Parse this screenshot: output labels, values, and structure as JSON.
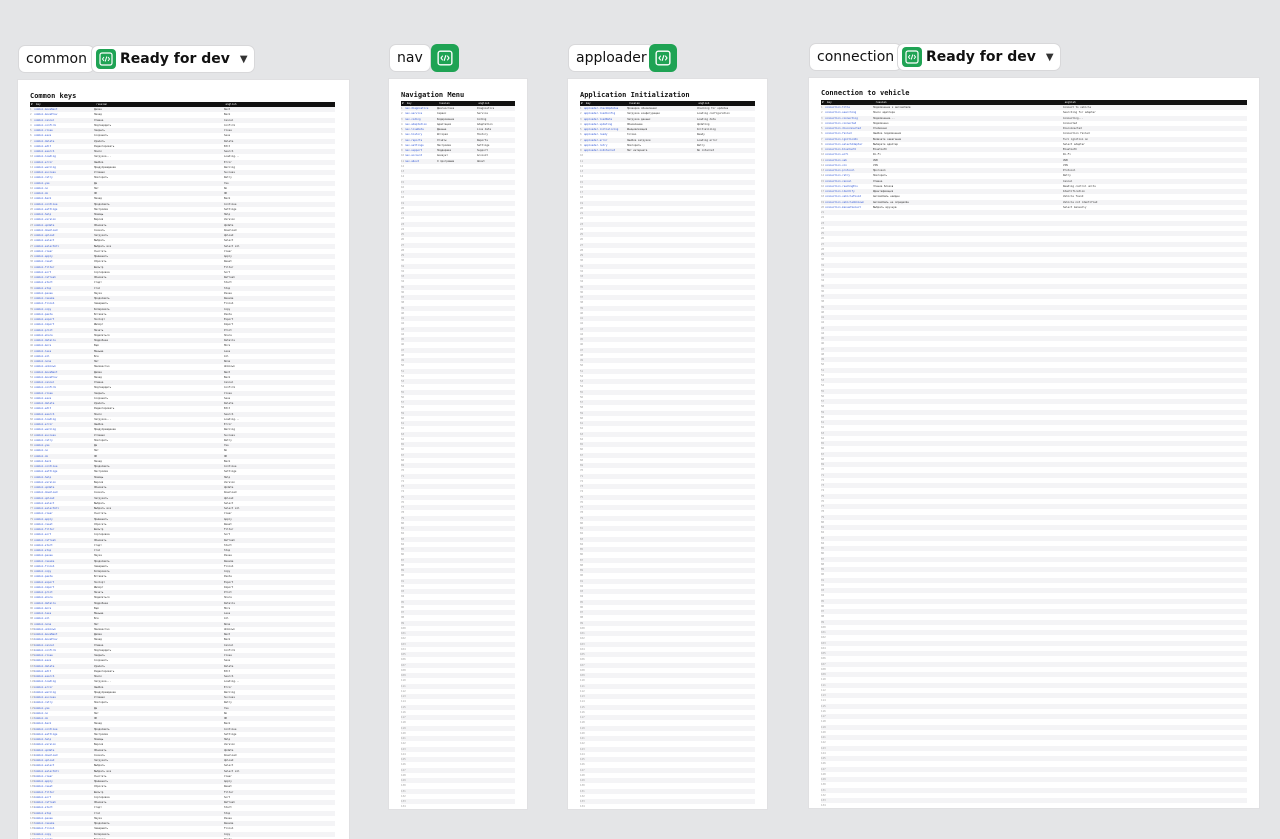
{
  "colors": {
    "canvas_bg": "#e4e5e7",
    "dev_green": "#1fa354",
    "link_blue": "#2e55d6",
    "header_black": "#111111"
  },
  "icons": {
    "dev_mode": "code-brackets-icon",
    "dropdown": "chevron-down-icon"
  },
  "sections": [
    {
      "name": "common",
      "status": "Ready for dev",
      "title": "Common keys"
    },
    {
      "name": "nav",
      "status": "",
      "title": "Navigation Menu"
    },
    {
      "name": "apploader",
      "status": "",
      "title": "Application Initialization"
    },
    {
      "name": "connection",
      "status": "Ready for dev",
      "title": "Connection to vehicle"
    }
  ],
  "table_headers": [
    "#",
    "key",
    "russian",
    "english"
  ],
  "tables": {
    "common": [
      [
        "common.moveNext",
        "Далее",
        "Next"
      ],
      [
        "common.movePrev",
        "Назад",
        "Back"
      ],
      [
        "common.cancel",
        "Отмена",
        "Cancel"
      ],
      [
        "common.confirm",
        "Подтвердить",
        "Confirm"
      ],
      [
        "common.close",
        "Закрыть",
        "Close"
      ],
      [
        "common.save",
        "Сохранить",
        "Save"
      ],
      [
        "common.delete",
        "Удалить",
        "Delete"
      ],
      [
        "common.edit",
        "Редактировать",
        "Edit"
      ],
      [
        "common.search",
        "Поиск",
        "Search"
      ],
      [
        "common.loading",
        "Загрузка...",
        "Loading..."
      ],
      [
        "common.error",
        "Ошибка",
        "Error"
      ],
      [
        "common.warning",
        "Предупреждение",
        "Warning"
      ],
      [
        "common.success",
        "Успешно",
        "Success"
      ],
      [
        "common.retry",
        "Повторить",
        "Retry"
      ],
      [
        "common.yes",
        "Да",
        "Yes"
      ],
      [
        "common.no",
        "Нет",
        "No"
      ],
      [
        "common.ok",
        "ОК",
        "OK"
      ],
      [
        "common.back",
        "Назад",
        "Back"
      ],
      [
        "common.continue",
        "Продолжить",
        "Continue"
      ],
      [
        "common.settings",
        "Настройки",
        "Settings"
      ],
      [
        "common.help",
        "Помощь",
        "Help"
      ],
      [
        "common.version",
        "Версия",
        "Version"
      ],
      [
        "common.update",
        "Обновить",
        "Update"
      ],
      [
        "common.download",
        "Скачать",
        "Download"
      ],
      [
        "common.upload",
        "Загрузить",
        "Upload"
      ],
      [
        "common.select",
        "Выбрать",
        "Select"
      ],
      [
        "common.selectAll",
        "Выбрать все",
        "Select all"
      ],
      [
        "common.clear",
        "Очистить",
        "Clear"
      ],
      [
        "common.apply",
        "Применить",
        "Apply"
      ],
      [
        "common.reset",
        "Сбросить",
        "Reset"
      ],
      [
        "common.filter",
        "Фильтр",
        "Filter"
      ],
      [
        "common.sort",
        "Сортировка",
        "Sort"
      ],
      [
        "common.refresh",
        "Обновить",
        "Refresh"
      ],
      [
        "common.start",
        "Старт",
        "Start"
      ],
      [
        "common.stop",
        "Стоп",
        "Stop"
      ],
      [
        "common.pause",
        "Пауза",
        "Pause"
      ],
      [
        "common.resume",
        "Продолжить",
        "Resume"
      ],
      [
        "common.finish",
        "Завершить",
        "Finish"
      ],
      [
        "common.copy",
        "Копировать",
        "Copy"
      ],
      [
        "common.paste",
        "Вставить",
        "Paste"
      ],
      [
        "common.export",
        "Экспорт",
        "Export"
      ],
      [
        "common.import",
        "Импорт",
        "Import"
      ],
      [
        "common.print",
        "Печать",
        "Print"
      ],
      [
        "common.share",
        "Поделиться",
        "Share"
      ],
      [
        "common.details",
        "Подробнее",
        "Details"
      ],
      [
        "common.more",
        "Ещё",
        "More"
      ],
      [
        "common.less",
        "Меньше",
        "Less"
      ],
      [
        "common.all",
        "Все",
        "All"
      ],
      [
        "common.none",
        "Нет",
        "None"
      ],
      [
        "common.unknown",
        "Неизвестно",
        "Unknown"
      ]
    ],
    "nav": [
      [
        "nav.diagnostics",
        "Диагностика",
        "Diagnostics"
      ],
      [
        "nav.service",
        "Сервис",
        "Service"
      ],
      [
        "nav.coding",
        "Кодирование",
        "Coding"
      ],
      [
        "nav.adaptation",
        "Адаптация",
        "Adaptation"
      ],
      [
        "nav.liveData",
        "Данные",
        "Live data"
      ],
      [
        "nav.history",
        "История",
        "History"
      ],
      [
        "nav.reports",
        "Отчёты",
        "Reports"
      ],
      [
        "nav.settings",
        "Настройки",
        "Settings"
      ],
      [
        "nav.support",
        "Поддержка",
        "Support"
      ],
      [
        "nav.account",
        "Аккаунт",
        "Account"
      ],
      [
        "nav.about",
        "О программе",
        "About"
      ]
    ],
    "apploader": [
      [
        "apploader.checkUpdates",
        "Проверка обновлений",
        "Checking for updates"
      ],
      [
        "apploader.loadConfig",
        "Загрузка конфигурации",
        "Loading configuration"
      ],
      [
        "apploader.loadData",
        "Загрузка данных",
        "Loading data"
      ],
      [
        "apploader.updating",
        "Обновление",
        "Updating"
      ],
      [
        "apploader.initializing",
        "Инициализация",
        "Initializing"
      ],
      [
        "apploader.ready",
        "Готово",
        "Ready"
      ],
      [
        "apploader.error",
        "Ошибка загрузки",
        "Loading error"
      ],
      [
        "apploader.retry",
        "Повторить",
        "Retry"
      ],
      [
        "apploader.noInternet",
        "Нет интернета",
        "No internet"
      ]
    ],
    "connection": [
      [
        "connection.title",
        "Подключение к автомобилю",
        "Connect to vehicle"
      ],
      [
        "connection.searching",
        "Поиск адаптера",
        "Searching for adapter"
      ],
      [
        "connection.connecting",
        "Подключение...",
        "Connecting..."
      ],
      [
        "connection.connected",
        "Подключено",
        "Connected"
      ],
      [
        "connection.disconnected",
        "Отключено",
        "Disconnected"
      ],
      [
        "connection.failed",
        "Ошибка подключения",
        "Connection failed"
      ],
      [
        "connection.ignitionOn",
        "Включите зажигание",
        "Turn ignition on"
      ],
      [
        "connection.selectAdapter",
        "Выберите адаптер",
        "Select adapter"
      ],
      [
        "connection.bluetooth",
        "Bluetooth",
        "Bluetooth"
      ],
      [
        "connection.wifi",
        "Wi-Fi",
        "Wi-Fi"
      ],
      [
        "connection.usb",
        "USB",
        "USB"
      ],
      [
        "connection.vin",
        "VIN",
        "VIN"
      ],
      [
        "connection.protocol",
        "Протокол",
        "Protocol"
      ],
      [
        "connection.retry",
        "Повторить",
        "Retry"
      ],
      [
        "connection.cancel",
        "Отмена",
        "Cancel"
      ],
      [
        "connection.readingEcu",
        "Чтение блоков",
        "Reading control units"
      ],
      [
        "connection.identify",
        "Идентификация",
        "Identification"
      ],
      [
        "connection.vehicleFound",
        "Автомобиль найден",
        "Vehicle found"
      ],
      [
        "connection.vehicleUnknown",
        "Автомобиль не определён",
        "Vehicle not identified"
      ],
      [
        "connection.manualSelect",
        "Выбрать вручную",
        "Select manually"
      ]
    ]
  }
}
